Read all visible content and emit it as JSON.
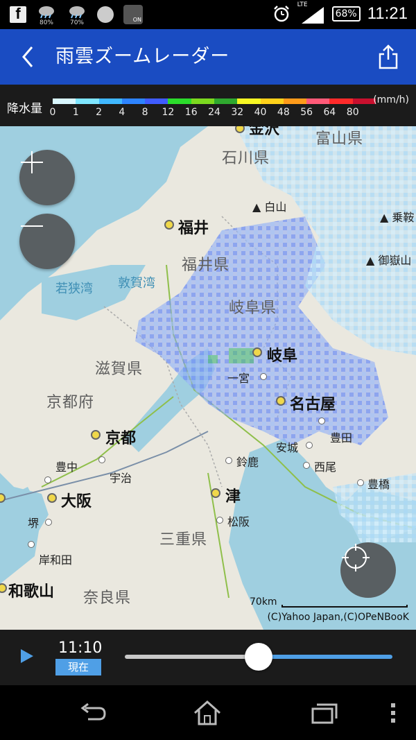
{
  "status_bar": {
    "icons": [
      "facebook-icon",
      "weather-rain-icon",
      "weather-rain-icon",
      "circle-icon",
      "wifi-on-icon",
      "alarm-icon",
      "lte-signal-icon",
      "battery-icon"
    ],
    "rain_pct_1": "80%",
    "rain_pct_2": "70%",
    "on_label": "ON",
    "network": "LTE",
    "battery": "68%",
    "time": "11:21"
  },
  "app_bar": {
    "title": "雨雲ズームレーダー",
    "back_icon": "chevron-left-icon",
    "share_icon": "share-icon",
    "color": "#1a4cc2"
  },
  "legend": {
    "title": "降水量",
    "unit": "(mm/h)",
    "ticks": [
      "0",
      "1",
      "2",
      "4",
      "8",
      "12",
      "16",
      "24",
      "32",
      "40",
      "48",
      "56",
      "64",
      "80"
    ],
    "colors": [
      "#d9f7ff",
      "#7fe6ff",
      "#40b8ff",
      "#2d84ff",
      "#3f5cff",
      "#2bdc2b",
      "#7cd91f",
      "#2fa82f",
      "#f7f723",
      "#ffd11a",
      "#ff9b1a",
      "#ff5a78",
      "#ff2a2a",
      "#c8102e"
    ]
  },
  "map": {
    "prefectures": [
      "石川県",
      "富山県",
      "福井県",
      "岐阜県",
      "滋賀県",
      "京都府",
      "三重県",
      "奈良県"
    ],
    "major_cities": [
      "金沢",
      "福井",
      "岐阜",
      "名古屋",
      "京都",
      "大阪",
      "津",
      "和歌山"
    ],
    "minor_cities": [
      "一宮",
      "豊田",
      "安城",
      "西尾",
      "鈴鹿",
      "豊中",
      "宇治",
      "豊橋",
      "松阪",
      "堺",
      "岸和田"
    ],
    "water": [
      "若狭湾",
      "敦賀湾"
    ],
    "mountains": [
      "白山",
      "乗鞍",
      "御嶽山"
    ],
    "scale_label": "70km",
    "copyright": "(C)Yahoo Japan,(C)OPeNBooK"
  },
  "controls": {
    "zoom_in_icon": "plus-icon",
    "zoom_out_icon": "minus-icon",
    "locate_icon": "crosshair-icon"
  },
  "player": {
    "play_icon": "play-icon",
    "time": "11:10",
    "now_label": "現在",
    "progress": 0.5,
    "accent": "#4f9fe6"
  },
  "nav_bar": {
    "icons": [
      "back-icon",
      "home-icon",
      "recents-icon",
      "menu-icon"
    ]
  }
}
